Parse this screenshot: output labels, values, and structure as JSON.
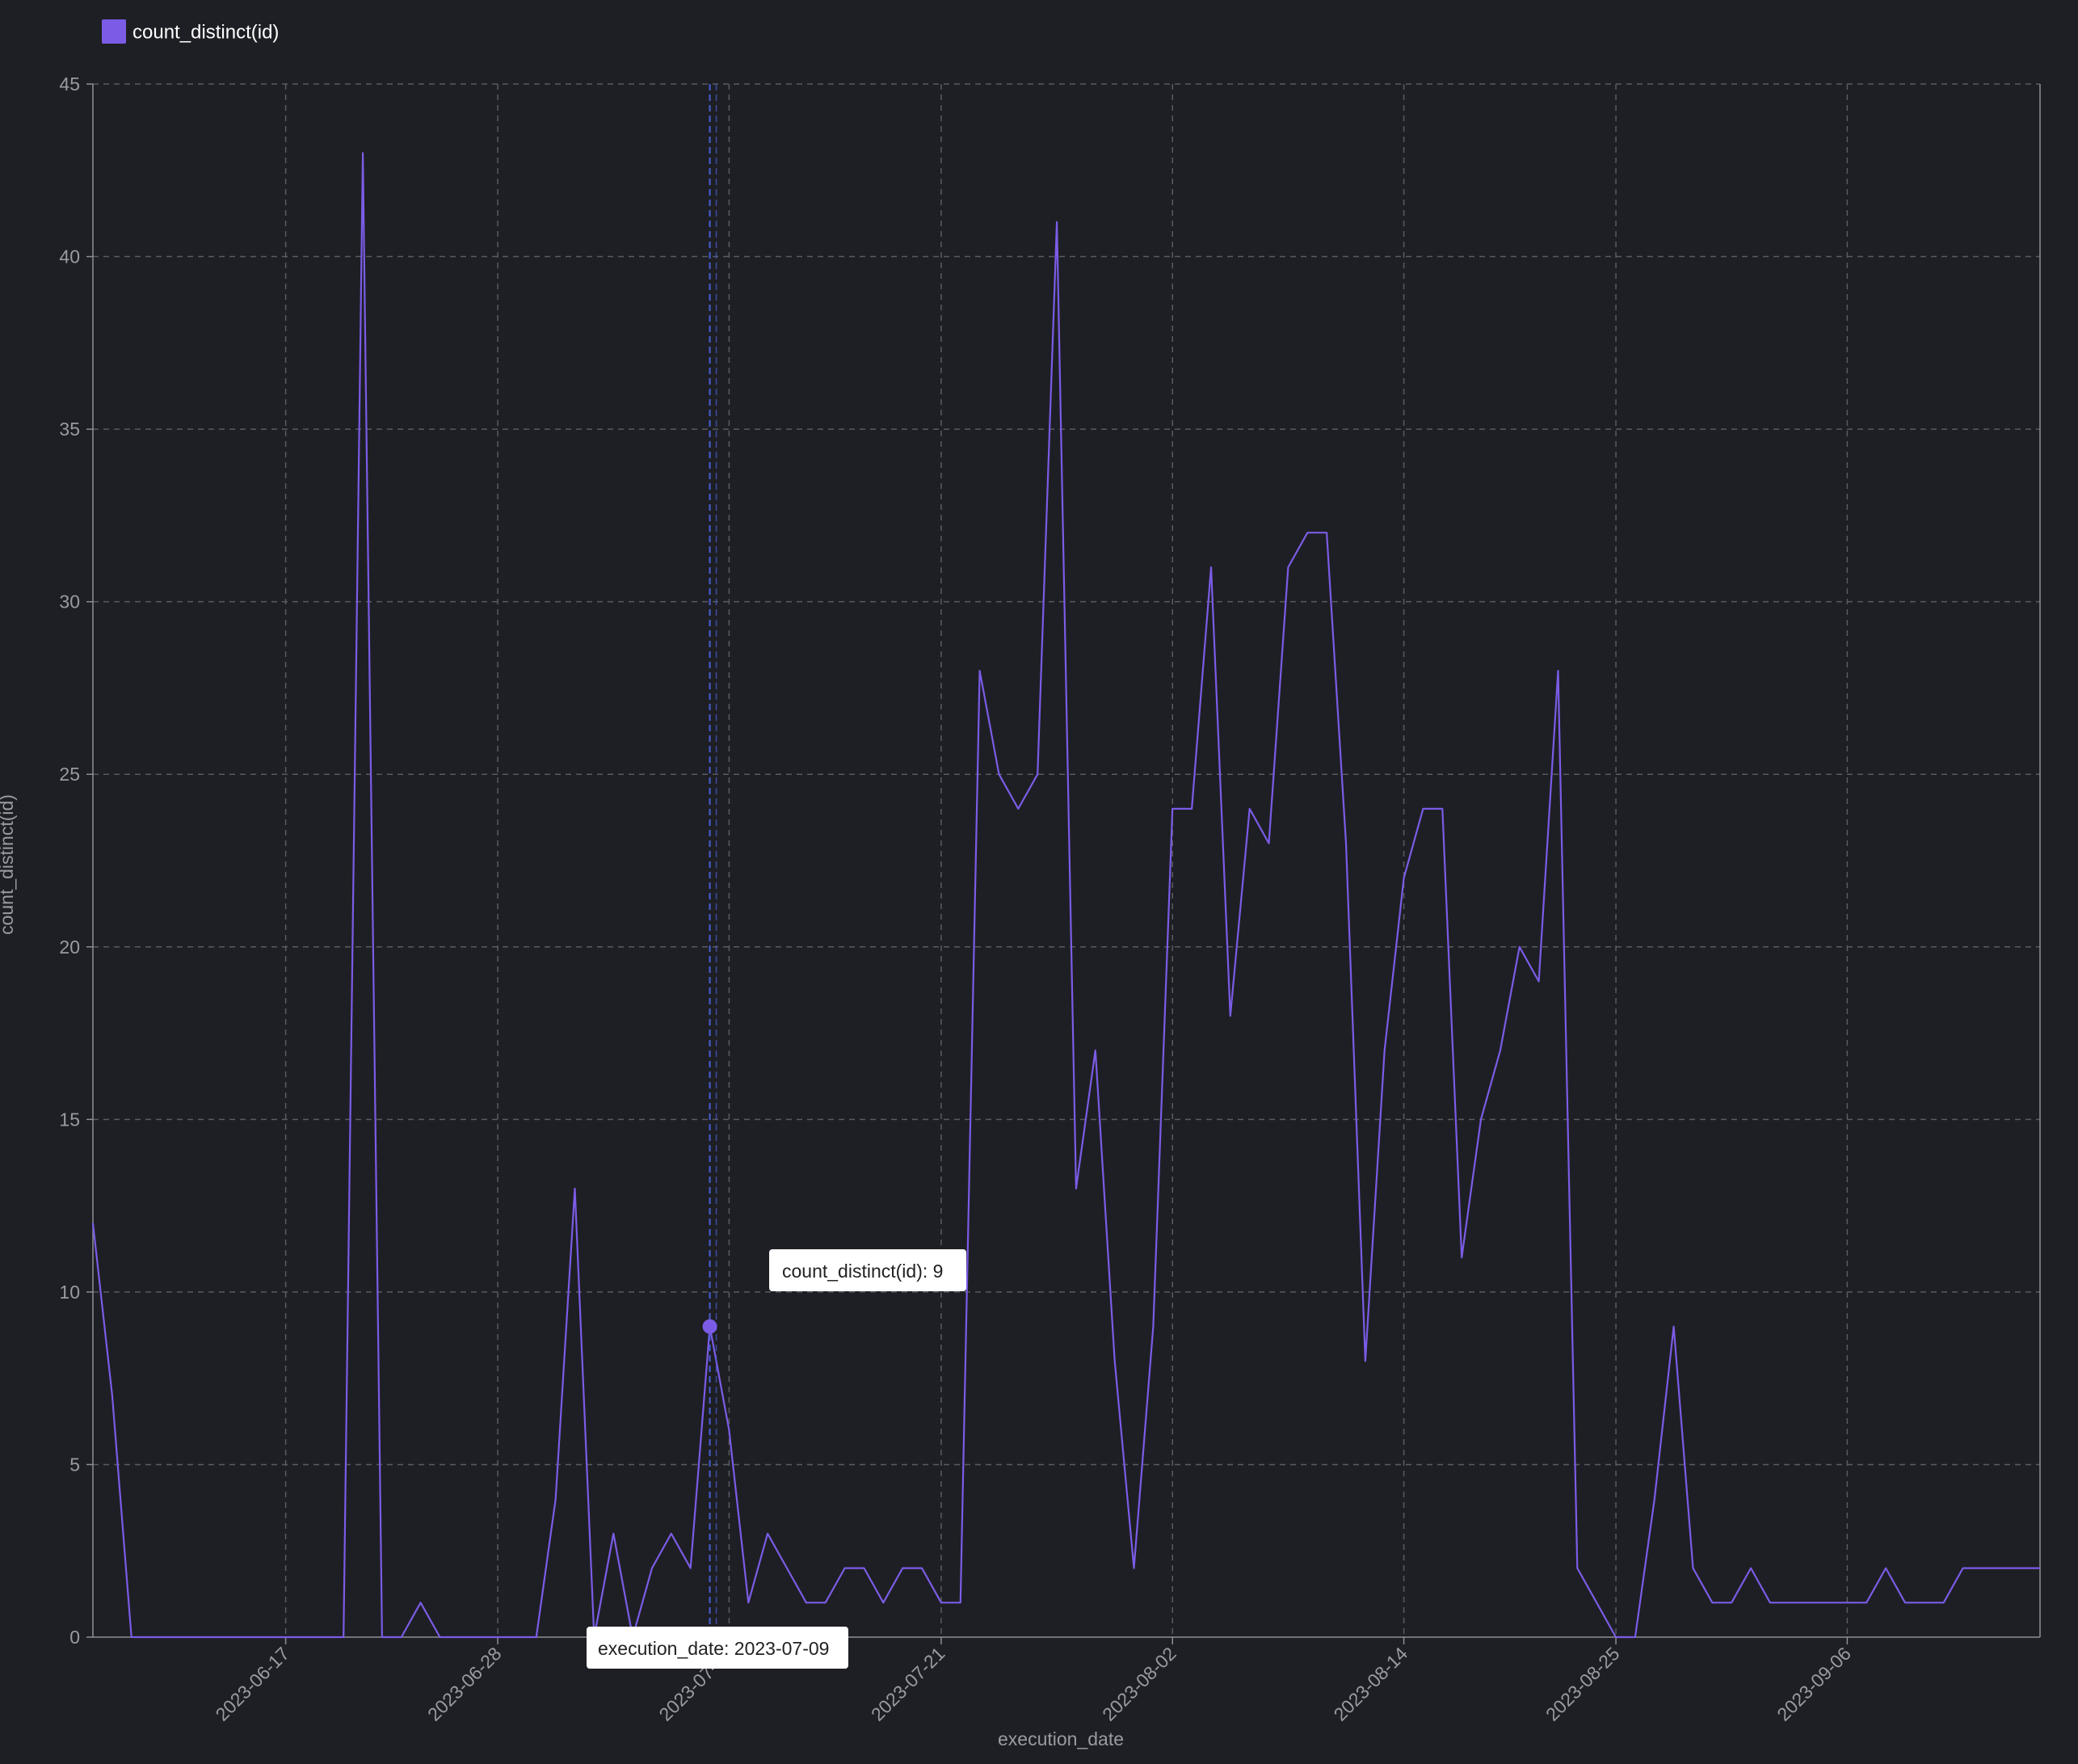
{
  "colors": {
    "background": "#1e1f24",
    "series": "#7b5ce6",
    "grid": "#5a5b61",
    "axis": "#8e8f94",
    "tick_text": "#9a9ba0",
    "legend_text": "#ffffff",
    "crosshair": "#4a5fd6",
    "tooltip_bg": "#ffffff",
    "tooltip_text": "#222222"
  },
  "chart_data": {
    "type": "line",
    "title": "",
    "xlabel": "execution_date",
    "ylabel": "count_distinct(id)",
    "legend": {
      "position": "top-left",
      "entries": [
        "count_distinct(id)"
      ]
    },
    "grid": true,
    "x_range": [
      "2023-06-07",
      "2023-09-16"
    ],
    "ylim": [
      0,
      45
    ],
    "y_ticks": [
      0,
      5,
      10,
      15,
      20,
      25,
      30,
      35,
      40,
      45
    ],
    "x_ticks": [
      "2023-06-17",
      "2023-06-28",
      "2023-07-10",
      "2023-07-21",
      "2023-08-02",
      "2023-08-14",
      "2023-08-25",
      "2023-09-06"
    ],
    "series": [
      {
        "name": "count_distinct(id)",
        "x": [
          "2023-06-07",
          "2023-06-08",
          "2023-06-09",
          "2023-06-10",
          "2023-06-11",
          "2023-06-12",
          "2023-06-13",
          "2023-06-14",
          "2023-06-15",
          "2023-06-16",
          "2023-06-17",
          "2023-06-18",
          "2023-06-19",
          "2023-06-20",
          "2023-06-21",
          "2023-06-22",
          "2023-06-23",
          "2023-06-24",
          "2023-06-25",
          "2023-06-26",
          "2023-06-27",
          "2023-06-28",
          "2023-06-29",
          "2023-06-30",
          "2023-07-01",
          "2023-07-02",
          "2023-07-03",
          "2023-07-04",
          "2023-07-05",
          "2023-07-06",
          "2023-07-07",
          "2023-07-08",
          "2023-07-09",
          "2023-07-10",
          "2023-07-11",
          "2023-07-12",
          "2023-07-13",
          "2023-07-14",
          "2023-07-15",
          "2023-07-16",
          "2023-07-17",
          "2023-07-18",
          "2023-07-19",
          "2023-07-20",
          "2023-07-21",
          "2023-07-22",
          "2023-07-23",
          "2023-07-24",
          "2023-07-25",
          "2023-07-26",
          "2023-07-27",
          "2023-07-28",
          "2023-07-29",
          "2023-07-30",
          "2023-07-31",
          "2023-08-01",
          "2023-08-02",
          "2023-08-03",
          "2023-08-04",
          "2023-08-05",
          "2023-08-06",
          "2023-08-07",
          "2023-08-08",
          "2023-08-09",
          "2023-08-10",
          "2023-08-11",
          "2023-08-12",
          "2023-08-13",
          "2023-08-14",
          "2023-08-15",
          "2023-08-16",
          "2023-08-17",
          "2023-08-18",
          "2023-08-19",
          "2023-08-20",
          "2023-08-21",
          "2023-08-22",
          "2023-08-23",
          "2023-08-24",
          "2023-08-25",
          "2023-08-26",
          "2023-08-27",
          "2023-08-28",
          "2023-08-29",
          "2023-08-30",
          "2023-08-31",
          "2023-09-01",
          "2023-09-02",
          "2023-09-03",
          "2023-09-04",
          "2023-09-05",
          "2023-09-06",
          "2023-09-07",
          "2023-09-08",
          "2023-09-09",
          "2023-09-10",
          "2023-09-11",
          "2023-09-12",
          "2023-09-13",
          "2023-09-14",
          "2023-09-15",
          "2023-09-16"
        ],
        "values": [
          12,
          7,
          0,
          0,
          0,
          0,
          0,
          0,
          0,
          0,
          0,
          0,
          0,
          0,
          43,
          0,
          0,
          1,
          0,
          0,
          0,
          0,
          0,
          0,
          4,
          13,
          0,
          3,
          0,
          2,
          3,
          2,
          9,
          6,
          1,
          3,
          2,
          1,
          1,
          2,
          2,
          1,
          2,
          2,
          1,
          1,
          28,
          25,
          24,
          25,
          41,
          13,
          17,
          8,
          2,
          9,
          24,
          24,
          31,
          18,
          24,
          23,
          31,
          32,
          32,
          23,
          8,
          17,
          22,
          24,
          24,
          11,
          15,
          17,
          20,
          19,
          28,
          2,
          1,
          0,
          0,
          4,
          9,
          2,
          1,
          1,
          2,
          1,
          1,
          1,
          1,
          1,
          1,
          2,
          1,
          1,
          1,
          2,
          2,
          2,
          2,
          2
        ]
      }
    ],
    "tooltip": {
      "x_label": "execution_date: 2023-07-09",
      "y_label": "count_distinct(id): 9",
      "x": "2023-07-09",
      "value": 9
    }
  }
}
